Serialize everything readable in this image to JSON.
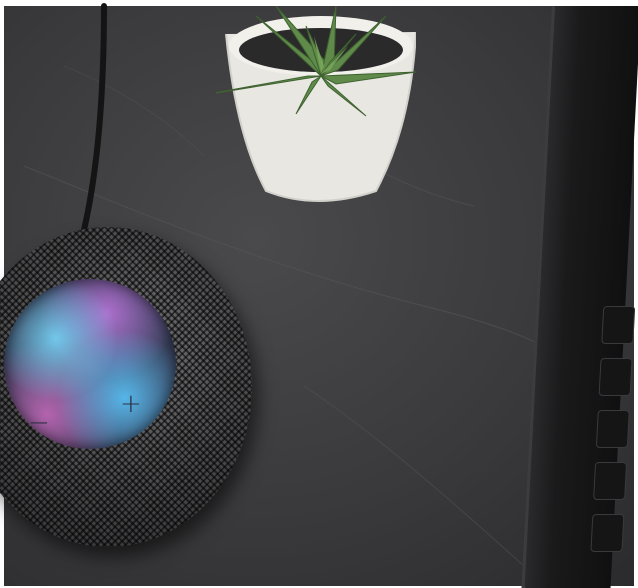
{
  "scene": {
    "colors": {
      "background": "#ffffff",
      "tabletop": "#3a3a3c",
      "pot": "#e9e7e2",
      "succulent": "#5f8a4a",
      "speaker_mesh": "#4e4e50",
      "laptop": "#1a1a1b"
    },
    "speaker": {
      "icon": "homepod-mini-icon",
      "minus_glyph": "−",
      "plus_glyph": "+"
    },
    "plant": {
      "icon": "succulent-icon"
    },
    "laptop": {
      "icon": "laptop-icon"
    }
  }
}
